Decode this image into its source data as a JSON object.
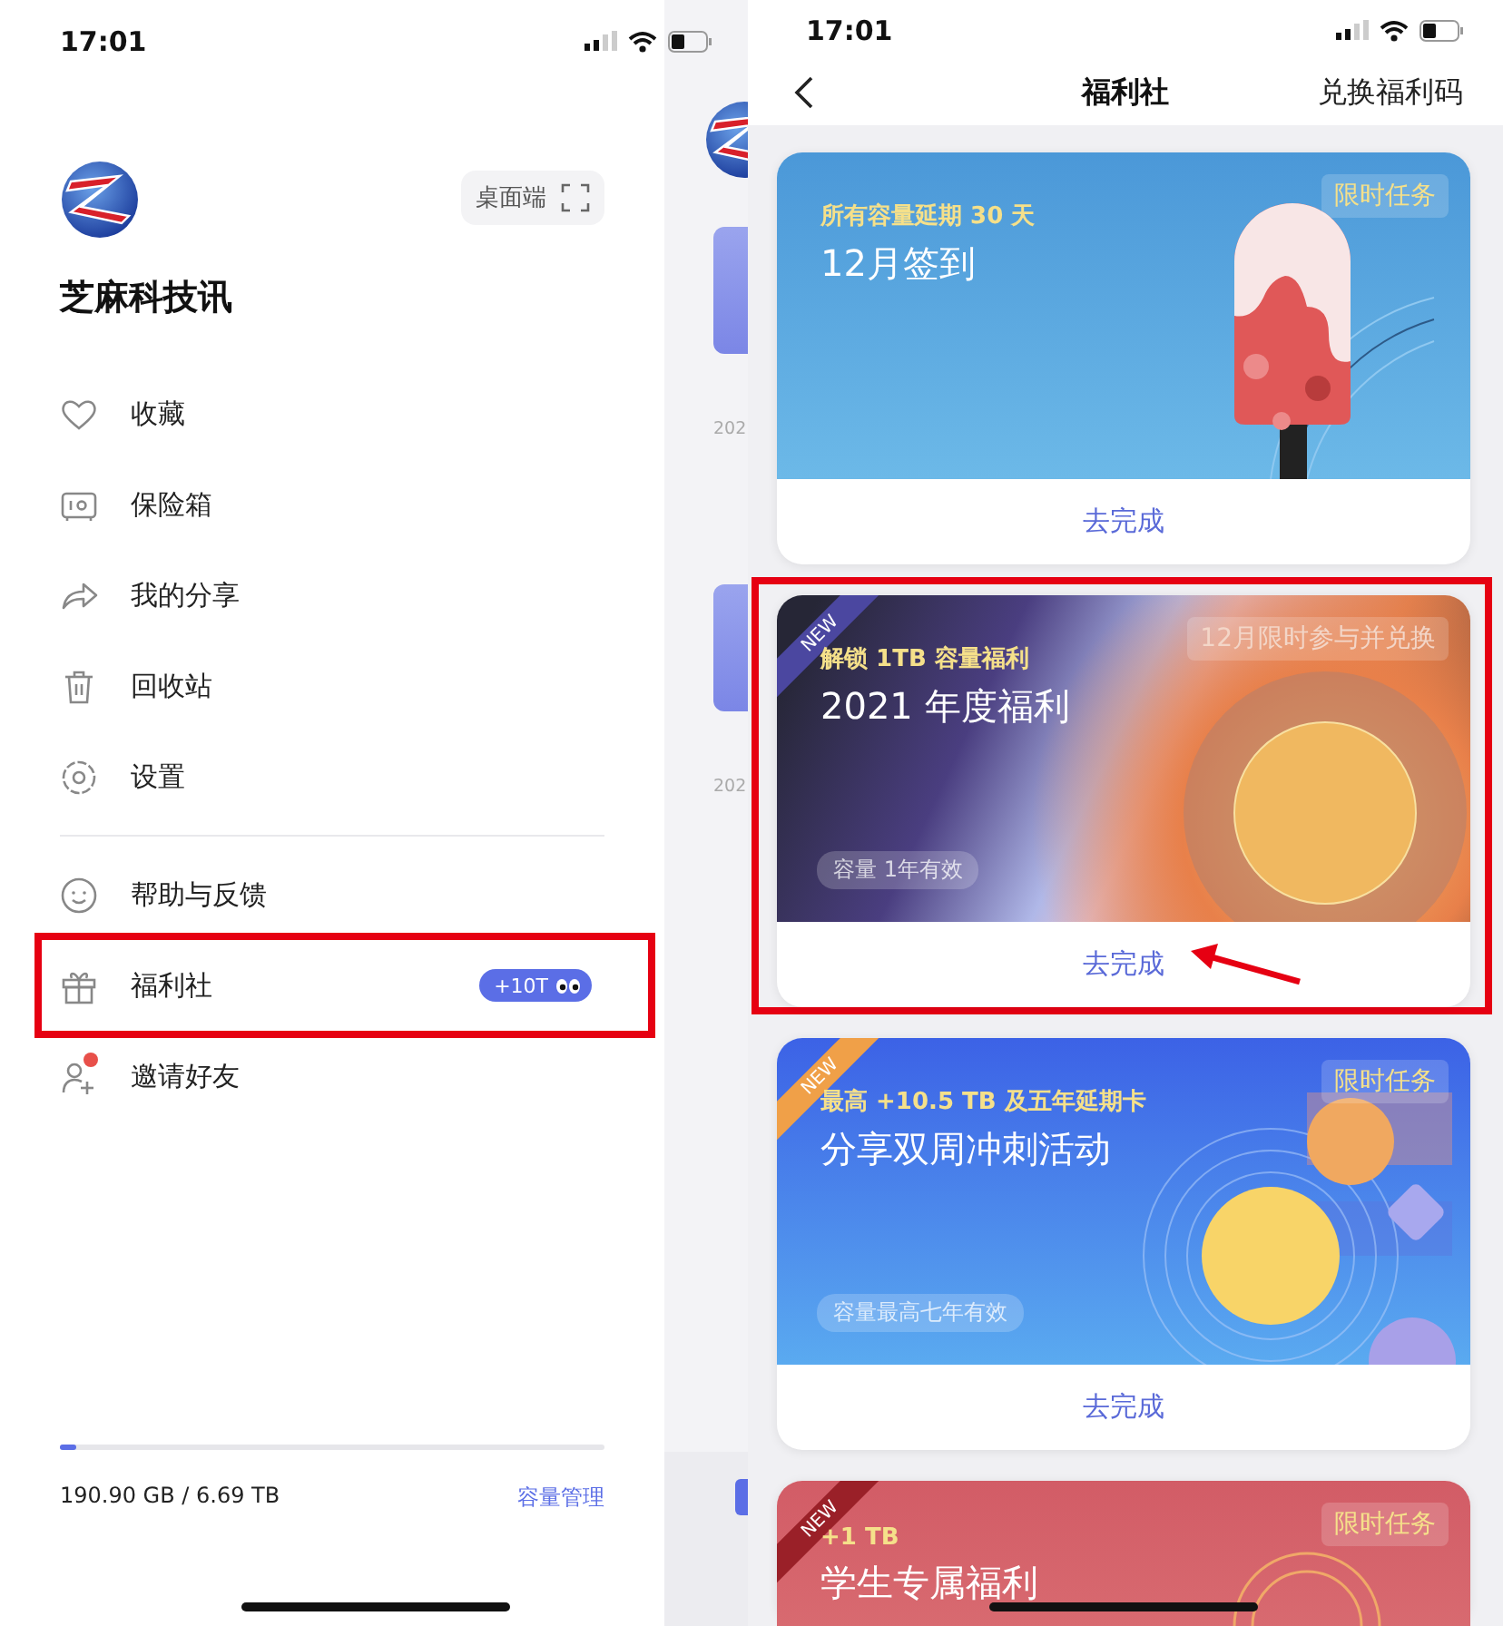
{
  "drawer_screen": {
    "status_bar": {
      "time": "17:01"
    },
    "profile": {
      "name": "芝麻科技讯"
    },
    "desktop_button": {
      "label": "桌面端"
    },
    "menu_groups": [
      [
        {
          "label": "收藏"
        },
        {
          "label": "保险箱"
        },
        {
          "label": "我的分享"
        },
        {
          "label": "回收站"
        },
        {
          "label": "设置"
        }
      ],
      [
        {
          "label": "帮助与反馈"
        },
        {
          "label": "福利社",
          "badge": "+10T",
          "highlighted": true
        },
        {
          "label": "邀请好友",
          "notification_dot": true
        }
      ]
    ],
    "storage": {
      "level": 0.03,
      "usage": "190.90 GB / 6.69 TB",
      "link": "容量管理"
    },
    "background_page": {
      "dates": [
        "202",
        "202"
      ]
    }
  },
  "welfare_screen": {
    "status_bar": {
      "time": "17:01"
    },
    "nav": {
      "title": "福利社",
      "action": "兑换福利码"
    },
    "cards": [
      {
        "kind": "popsicle",
        "subtitle": "所有容量延期 30 天",
        "title": "12月签到",
        "tag": "限时任务",
        "action": "去完成"
      },
      {
        "kind": "annual",
        "ribbon": "NEW",
        "subtitle": "解锁 1TB 容量福利",
        "title": "2021 年度福利",
        "tag": "12月限时参与并兑换",
        "validity": "容量 1年有效",
        "action": "去完成",
        "highlighted": true,
        "pointer_arrow": true
      },
      {
        "kind": "share",
        "ribbon": "NEW",
        "subtitle": "最高 +10.5 TB 及五年延期卡",
        "title": "分享双周冲刺活动",
        "tag": "限时任务",
        "validity": "容量最高七年有效",
        "action": "去完成"
      },
      {
        "kind": "student",
        "ribbon": "NEW",
        "subtitle": "+1 TB",
        "title": "学生专属福利",
        "tag": "限时任务"
      }
    ]
  }
}
